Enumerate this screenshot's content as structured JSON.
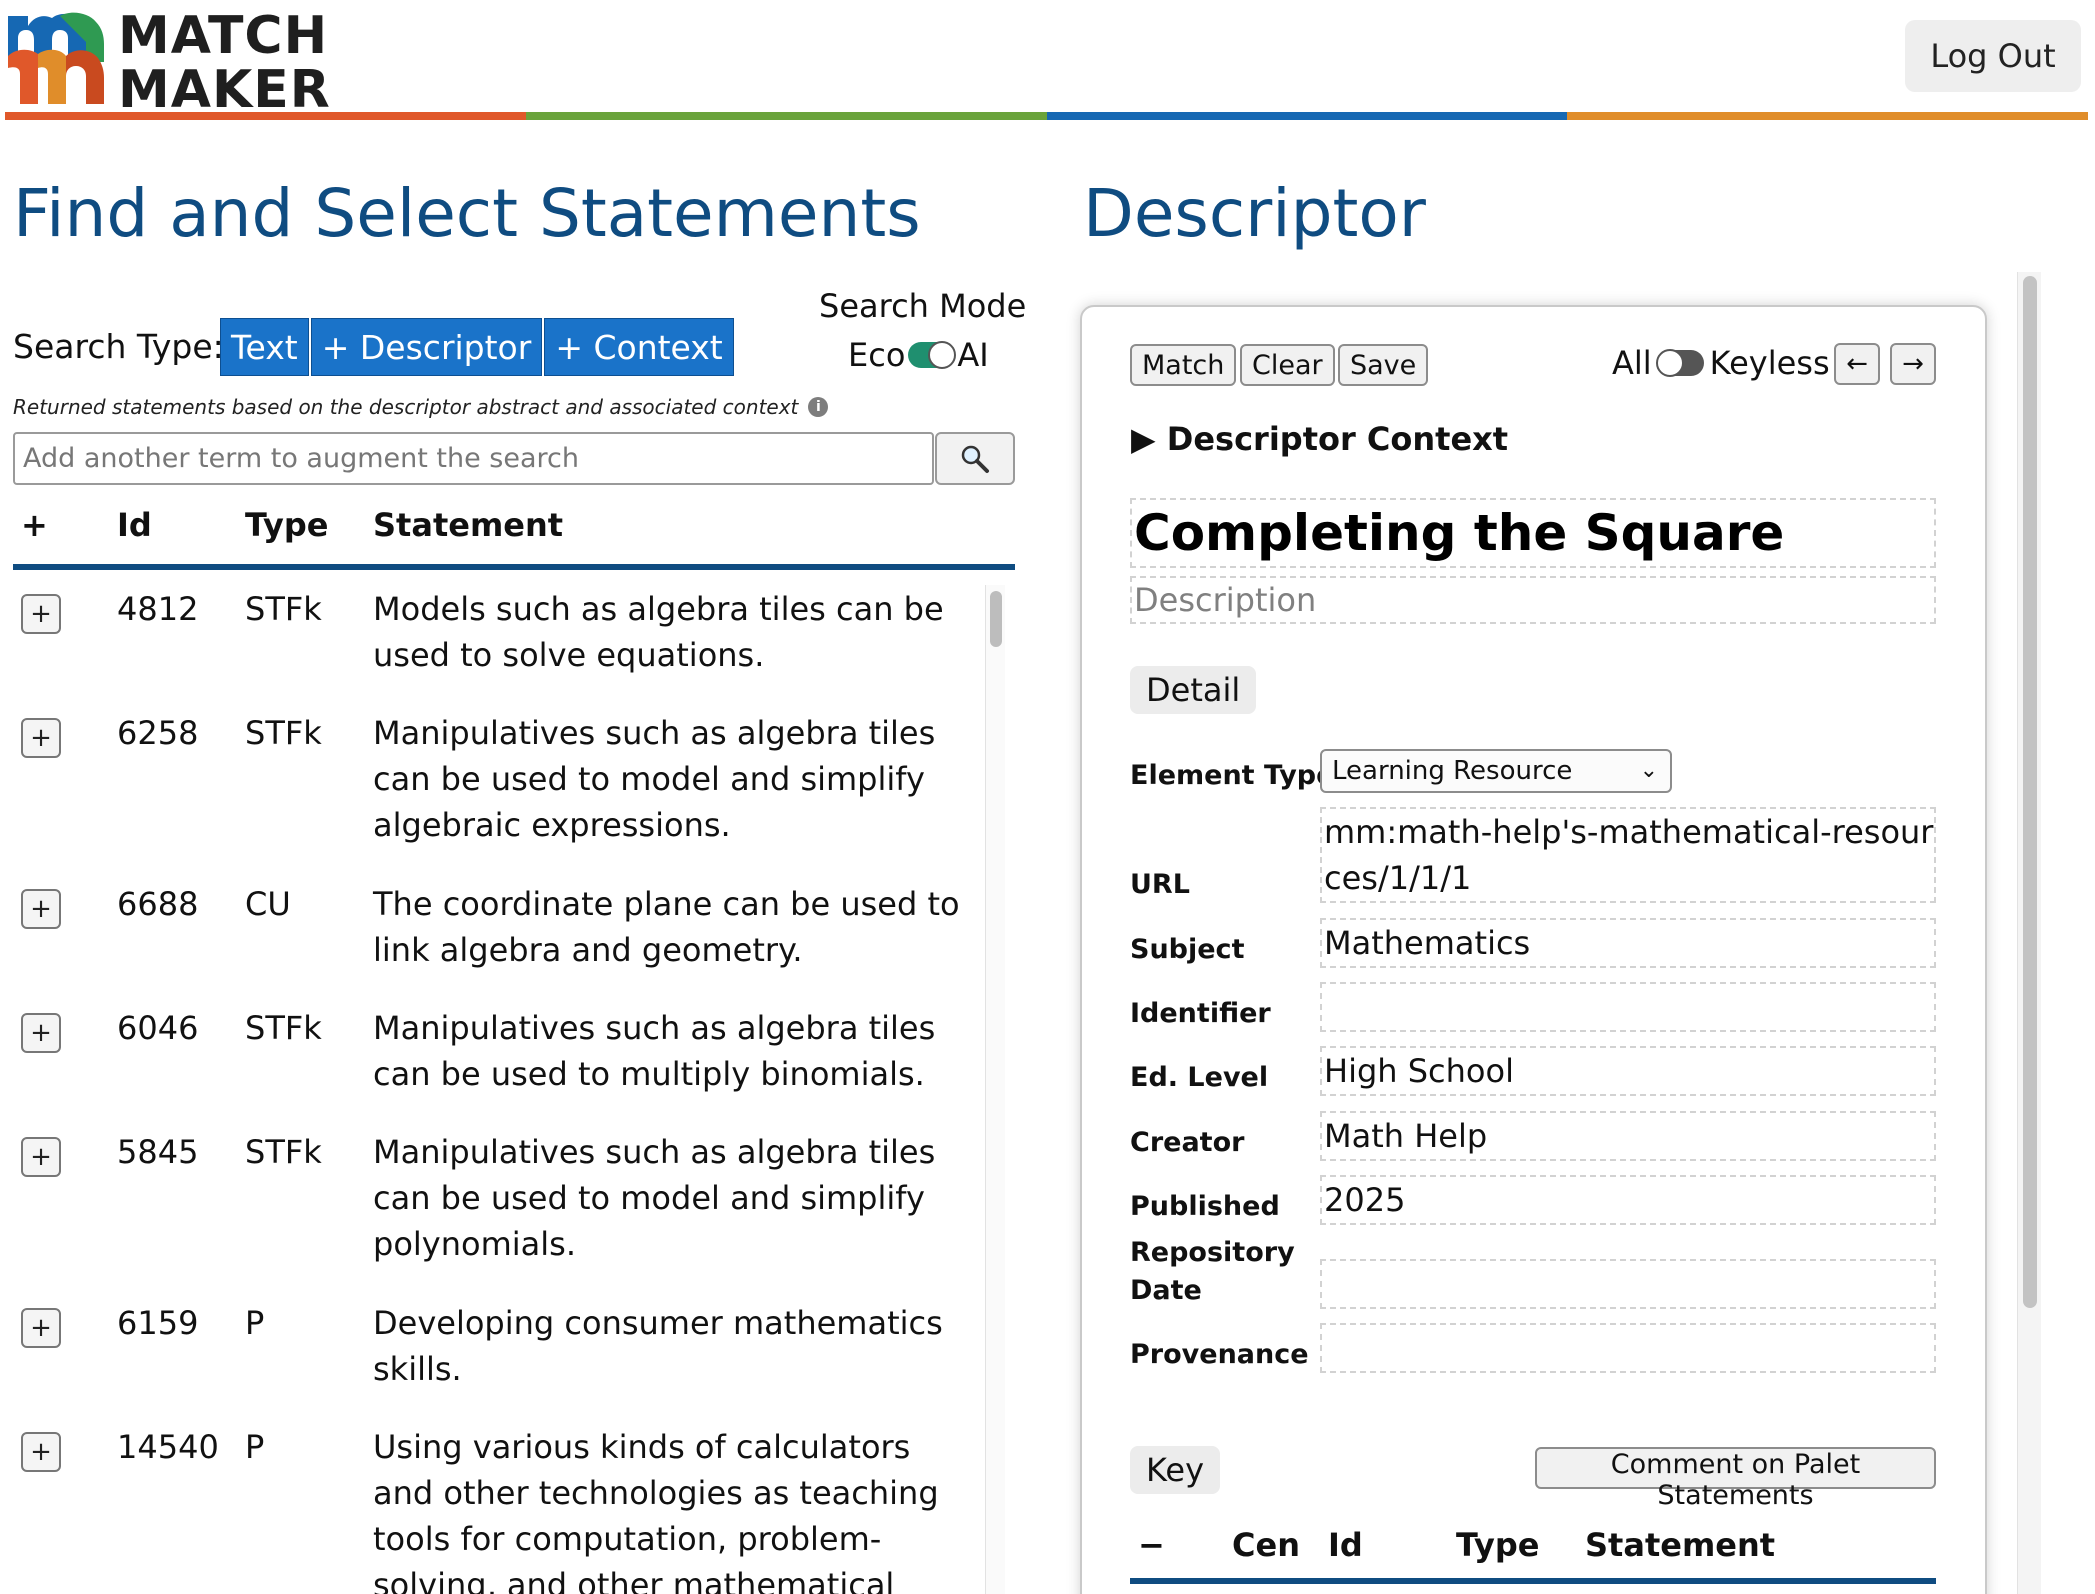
{
  "header": {
    "logo": {
      "line1": "MATCH",
      "line2": "MAKER"
    },
    "logout_label": "Log Out",
    "rule_colors": [
      "#e0582a",
      "#6aa33b",
      "#1668b3",
      "#e08d2a"
    ]
  },
  "left": {
    "title": "Find and Select Statements",
    "search_type_label": "Search Type:",
    "search_types": [
      "Text",
      "+ Descriptor",
      "+ Context"
    ],
    "search_mode_label": "Search Mode",
    "mode_left": "Eco",
    "mode_right": "AI",
    "mode_toggle_on": true,
    "note": "Returned statements based on the descriptor abstract and associated context",
    "search_placeholder": "Add another term to augment the search",
    "columns": {
      "add": "+",
      "id": "Id",
      "type": "Type",
      "statement": "Statement"
    },
    "rows": [
      {
        "id": "4812",
        "type": "STFk",
        "statement": "Models such as algebra tiles can be used to solve equations."
      },
      {
        "id": "6258",
        "type": "STFk",
        "statement": "Manipulatives such as algebra tiles can be used to model and simplify algebraic expressions."
      },
      {
        "id": "6688",
        "type": "CU",
        "statement": "The coordinate plane can be used to link algebra and geometry."
      },
      {
        "id": "6046",
        "type": "STFk",
        "statement": "Manipulatives such as algebra tiles can be used to multiply binomials."
      },
      {
        "id": "5845",
        "type": "STFk",
        "statement": "Manipulatives such as algebra tiles can be used to model and simplify polynomials."
      },
      {
        "id": "6159",
        "type": "P",
        "statement": "Developing consumer mathematics skills."
      },
      {
        "id": "14540",
        "type": "P",
        "statement": "Using various kinds of calculators and other technologies as teaching tools for computation, problem-solving, and other mathematical explorations."
      }
    ]
  },
  "right": {
    "title": "Descriptor",
    "buttons": {
      "match": "Match",
      "clear": "Clear",
      "save": "Save"
    },
    "all_label": "All",
    "keyless_label": "Keyless",
    "keyless_toggle_on": false,
    "prev_arrow": "←",
    "next_arrow": "→",
    "context_summary": "Descriptor Context",
    "descriptor_title": "Completing the Square",
    "description_placeholder": "Description",
    "detail_label": "Detail",
    "fields": {
      "element_type": {
        "label": "Element Type",
        "value": "Learning Resource"
      },
      "url": {
        "label": "URL",
        "value": "mm:math-help's-mathematical-resources/1/1/1"
      },
      "subject": {
        "label": "Subject",
        "value": "Mathematics"
      },
      "identifier": {
        "label": "Identifier",
        "value": ""
      },
      "ed_level": {
        "label": "Ed. Level",
        "value": "High School"
      },
      "creator": {
        "label": "Creator",
        "value": "Math Help"
      },
      "published": {
        "label": "Published",
        "value": "2025"
      },
      "repository_date": {
        "label": "Repository Date",
        "value": ""
      },
      "provenance": {
        "label": "Provenance",
        "value": ""
      }
    },
    "key_label": "Key",
    "comment_label": "Comment on Palet Statements",
    "key_columns": {
      "minus": "−",
      "cen": "Cen",
      "id": "Id",
      "type": "Type",
      "statement": "Statement"
    }
  }
}
